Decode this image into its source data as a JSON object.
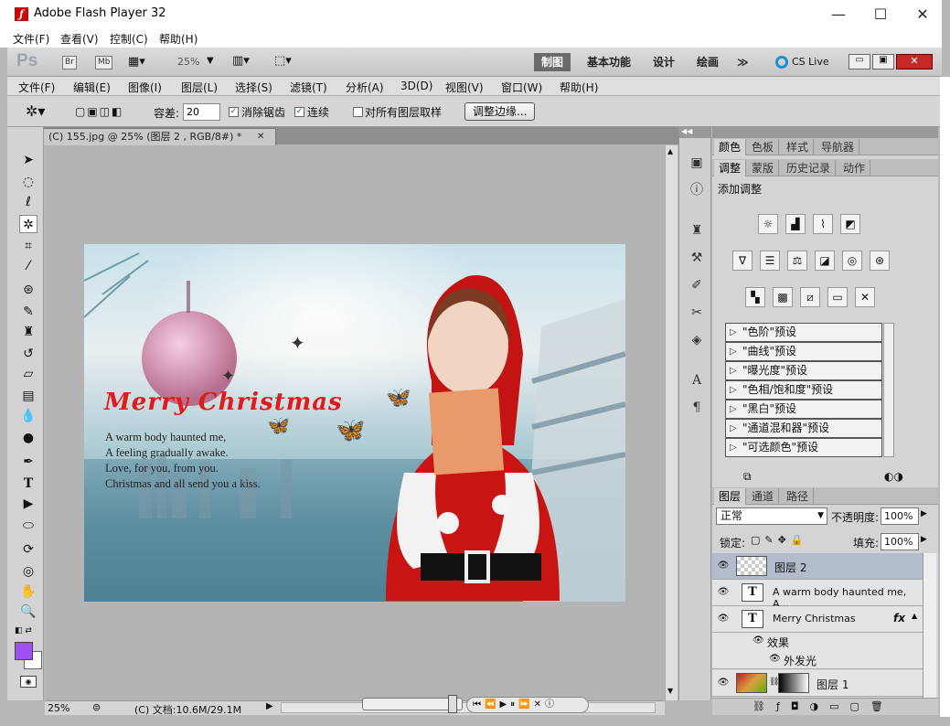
{
  "outer_window": {
    "title": "Adobe Flash Player 32",
    "menu": [
      "文件(F)",
      "查看(V)",
      "控制(C)",
      "帮助(H)"
    ]
  },
  "appbar": {
    "logo": "Ps",
    "br": "Br",
    "mb": "Mb",
    "zoom": "25%",
    "workspaces": [
      "制图",
      "基本功能",
      "设计",
      "绘画"
    ],
    "more": "≫",
    "cslive": "CS Live"
  },
  "menu": [
    "文件(F)",
    "编辑(E)",
    "图像(I)",
    "图层(L)",
    "选择(S)",
    "滤镜(T)",
    "分析(A)",
    "3D(D)",
    "视图(V)",
    "窗口(W)",
    "帮助(H)"
  ],
  "options": {
    "tolerance_label": "容差:",
    "tolerance_value": "20",
    "antialias": "消除锯齿",
    "contiguous": "连续",
    "sample_all": "对所有图层取样",
    "refine_edge": "调整边缘..."
  },
  "document": {
    "tab": "(C) 155.jpg @ 25% (图层 2 , RGB/8#) *",
    "close": "✕"
  },
  "artwork": {
    "headline": "Merry Christmas",
    "lines": [
      "A warm body haunted me,",
      "A feeling gradually awake.",
      "Love, for you, from you.",
      "Christmas and all send you a kiss."
    ]
  },
  "status": {
    "zoom": "25%",
    "doc": "(C) 文档:10.6M/29.1M"
  },
  "panels": {
    "top_tabs": [
      "颜色",
      "色板",
      "样式",
      "导航器"
    ],
    "adj_tabs": [
      "调整",
      "蒙版",
      "历史记录",
      "动作"
    ],
    "adj_title": "添加调整",
    "presets": [
      "\"色阶\"预设",
      "\"曲线\"预设",
      "\"曝光度\"预设",
      "\"色相/饱和度\"预设",
      "\"黑白\"预设",
      "\"通道混和器\"预设",
      "\"可选颜色\"预设"
    ],
    "layer_tabs": [
      "图层",
      "通道",
      "路径"
    ],
    "blend_mode": "正常",
    "opacity_label": "不透明度:",
    "opacity": "100%",
    "lock_label": "锁定:",
    "fill_label": "填充:",
    "fill": "100%",
    "layers": [
      {
        "name": "图层 2",
        "kind": "raster"
      },
      {
        "name": "A warm body haunted me, A...",
        "kind": "text"
      },
      {
        "name": "Merry Christmas",
        "kind": "text",
        "fx": "fx"
      },
      {
        "name": "效果",
        "kind": "effect"
      },
      {
        "name": "外发光",
        "kind": "effect-item"
      },
      {
        "name": "图层 1",
        "kind": "masked"
      }
    ]
  },
  "colors": {
    "foreground": "#a050f0",
    "background": "#ffffff",
    "headline": "#e01b1b",
    "workspace_active": "#6a6a6a"
  }
}
